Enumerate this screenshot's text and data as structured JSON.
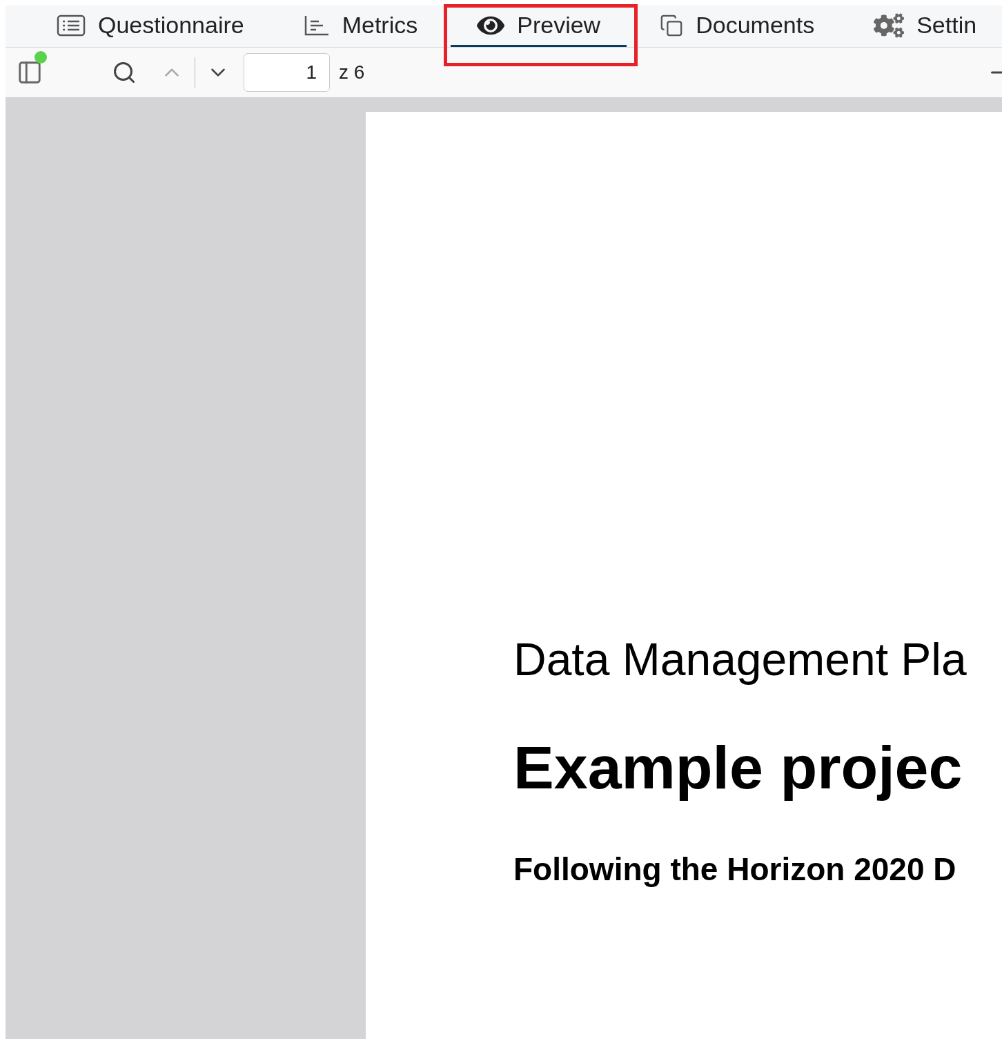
{
  "tabs": [
    {
      "kind": "list",
      "label": "Questionnaire",
      "selected": false,
      "highlighted": false
    },
    {
      "kind": "metrics",
      "label": "Metrics",
      "selected": false,
      "highlighted": false
    },
    {
      "kind": "eye",
      "label": "Preview",
      "selected": true,
      "highlighted": true
    },
    {
      "kind": "documents",
      "label": "Documents",
      "selected": false,
      "highlighted": false
    },
    {
      "kind": "settings",
      "label": "Settin",
      "selected": false,
      "highlighted": false
    }
  ],
  "toolbar": {
    "sidebar_badge": true,
    "page_input": {
      "value": "1"
    },
    "page_count": "z 6"
  },
  "document": {
    "heading": "Data Management Pla",
    "title": "Example projec",
    "subtitle": "Following the Horizon 2020 D"
  }
}
